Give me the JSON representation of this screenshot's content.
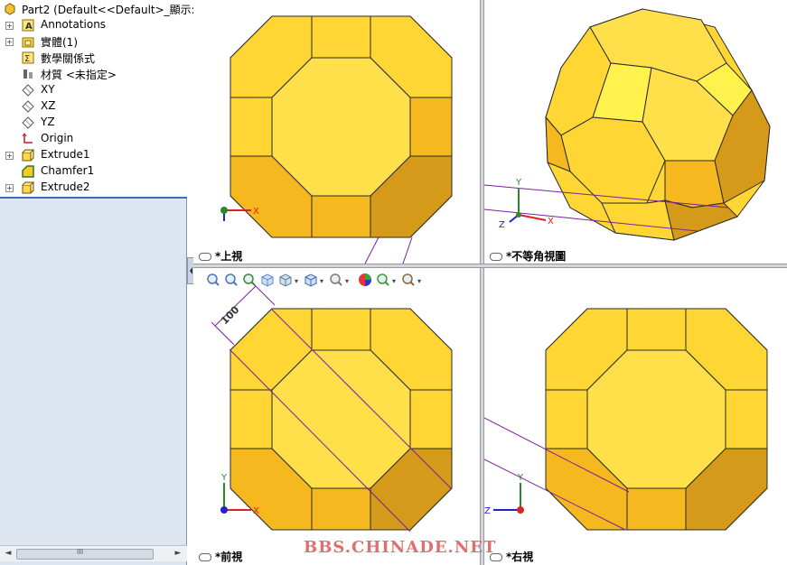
{
  "tree": {
    "items": [
      {
        "label": "Part2  (Default<<Default>_顯示:",
        "icon": "part-icon",
        "expander": ""
      },
      {
        "label": "Annotations",
        "icon": "annotations-icon",
        "expander": "+"
      },
      {
        "label": "實體(1)",
        "icon": "solid-bodies-icon",
        "expander": "+"
      },
      {
        "label": "數學關係式",
        "icon": "equations-icon",
        "expander": ""
      },
      {
        "label": "材質 <未指定>",
        "icon": "material-icon",
        "expander": ""
      },
      {
        "label": "XY",
        "icon": "plane-icon",
        "expander": ""
      },
      {
        "label": "XZ",
        "icon": "plane-icon",
        "expander": ""
      },
      {
        "label": "YZ",
        "icon": "plane-icon",
        "expander": ""
      },
      {
        "label": "Origin",
        "icon": "origin-icon",
        "expander": ""
      },
      {
        "label": "Extrude1",
        "icon": "extrude-icon",
        "expander": "+"
      },
      {
        "label": "Chamfer1",
        "icon": "chamfer-icon",
        "expander": ""
      },
      {
        "label": "Extrude2",
        "icon": "extrude-icon",
        "expander": "+"
      }
    ],
    "scroll_left": "◄",
    "scroll_right": "►",
    "scroll_grip": "III"
  },
  "viewports": {
    "top": {
      "label": "*上視"
    },
    "iso": {
      "label": "*不等角視圖"
    },
    "front": {
      "label": "*前視",
      "dimension": "100"
    },
    "right": {
      "label": "*右視"
    }
  },
  "triad": {
    "x": "X",
    "y": "Y",
    "z": "Z"
  },
  "toolbar": {
    "icons": [
      "zoom-to-fit-icon",
      "zoom-to-area-icon",
      "previous-view-icon",
      "section-view-icon",
      "view-orientation-icon",
      "display-style-icon",
      "hide-show-items-icon",
      "edit-appearance-icon",
      "apply-scene-icon",
      "view-settings-icon"
    ]
  },
  "watermark": "BBS.CHINADE.NET",
  "colors": {
    "face_main": "#FFD633",
    "face_light": "#FFE04A",
    "face_mid": "#F5B81E",
    "face_dark": "#D59A1A",
    "face_highlight": "#FFF24D",
    "edge": "#2a2a2a",
    "sketch_line": "#7a1fa2",
    "tree_bg": "#dde6f0",
    "selection_blue": "#3b6fb6"
  }
}
